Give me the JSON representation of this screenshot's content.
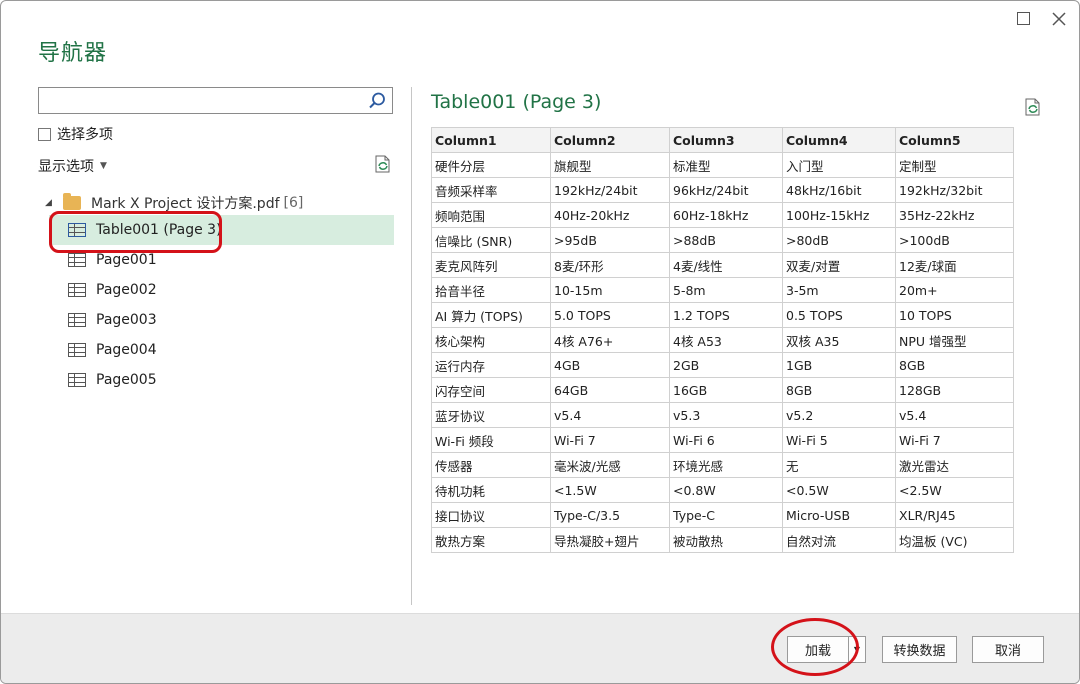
{
  "dialog": {
    "title": "导航器"
  },
  "search": {
    "value": "",
    "placeholder": ""
  },
  "select_multiple_label": "选择多项",
  "display_options_label": "显示选项",
  "tree": {
    "root_label": "Mark X Project 设计方案.pdf",
    "root_count": "[6]",
    "items": [
      {
        "label": "Table001 (Page 3)"
      },
      {
        "label": "Page001"
      },
      {
        "label": "Page002"
      },
      {
        "label": "Page003"
      },
      {
        "label": "Page004"
      },
      {
        "label": "Page005"
      }
    ]
  },
  "preview": {
    "title": "Table001 (Page 3)",
    "columns": [
      "Column1",
      "Column2",
      "Column3",
      "Column4",
      "Column5"
    ],
    "rows": [
      [
        "硬件分层",
        "旗舰型",
        "标准型",
        "入门型",
        "定制型"
      ],
      [
        "音频采样率",
        "192kHz/24bit",
        "96kHz/24bit",
        "48kHz/16bit",
        "192kHz/32bit"
      ],
      [
        "频响范围",
        "40Hz-20kHz",
        "60Hz-18kHz",
        "100Hz-15kHz",
        "35Hz-22kHz"
      ],
      [
        "信噪比 (SNR)",
        ">95dB",
        ">88dB",
        ">80dB",
        ">100dB"
      ],
      [
        "麦克风阵列",
        "8麦/环形",
        "4麦/线性",
        "双麦/对置",
        "12麦/球面"
      ],
      [
        "拾音半径",
        "10-15m",
        "5-8m",
        "3-5m",
        "20m+"
      ],
      [
        "AI 算力 (TOPS)",
        "5.0 TOPS",
        "1.2 TOPS",
        "0.5 TOPS",
        "10 TOPS"
      ],
      [
        "核心架构",
        "4核 A76+",
        "4核 A53",
        "双核 A35",
        "NPU 增强型"
      ],
      [
        "运行内存",
        "4GB",
        "2GB",
        "1GB",
        "8GB"
      ],
      [
        "闪存空间",
        "64GB",
        "16GB",
        "8GB",
        "128GB"
      ],
      [
        "蓝牙协议",
        "v5.4",
        "v5.3",
        "v5.2",
        "v5.4"
      ],
      [
        "Wi-Fi 频段",
        "Wi-Fi 7",
        "Wi-Fi 6",
        "Wi-Fi 5",
        "Wi-Fi 7"
      ],
      [
        "传感器",
        "毫米波/光感",
        "环境光感",
        "无",
        "激光雷达"
      ],
      [
        "待机功耗",
        "<1.5W",
        "<0.8W",
        "<0.5W",
        "<2.5W"
      ],
      [
        "接口协议",
        "Type-C/3.5",
        "Type-C",
        "Micro-USB",
        "XLR/RJ45"
      ],
      [
        "散热方案",
        "导热凝胶+翅片",
        "被动散热",
        "自然对流",
        "均温板 (VC)"
      ]
    ]
  },
  "footer": {
    "load_label": "加载",
    "transform_label": "转换数据",
    "cancel_label": "取消"
  },
  "colors": {
    "accent": "#217346",
    "selection": "#d7eddf",
    "annotation": "#d41219"
  }
}
